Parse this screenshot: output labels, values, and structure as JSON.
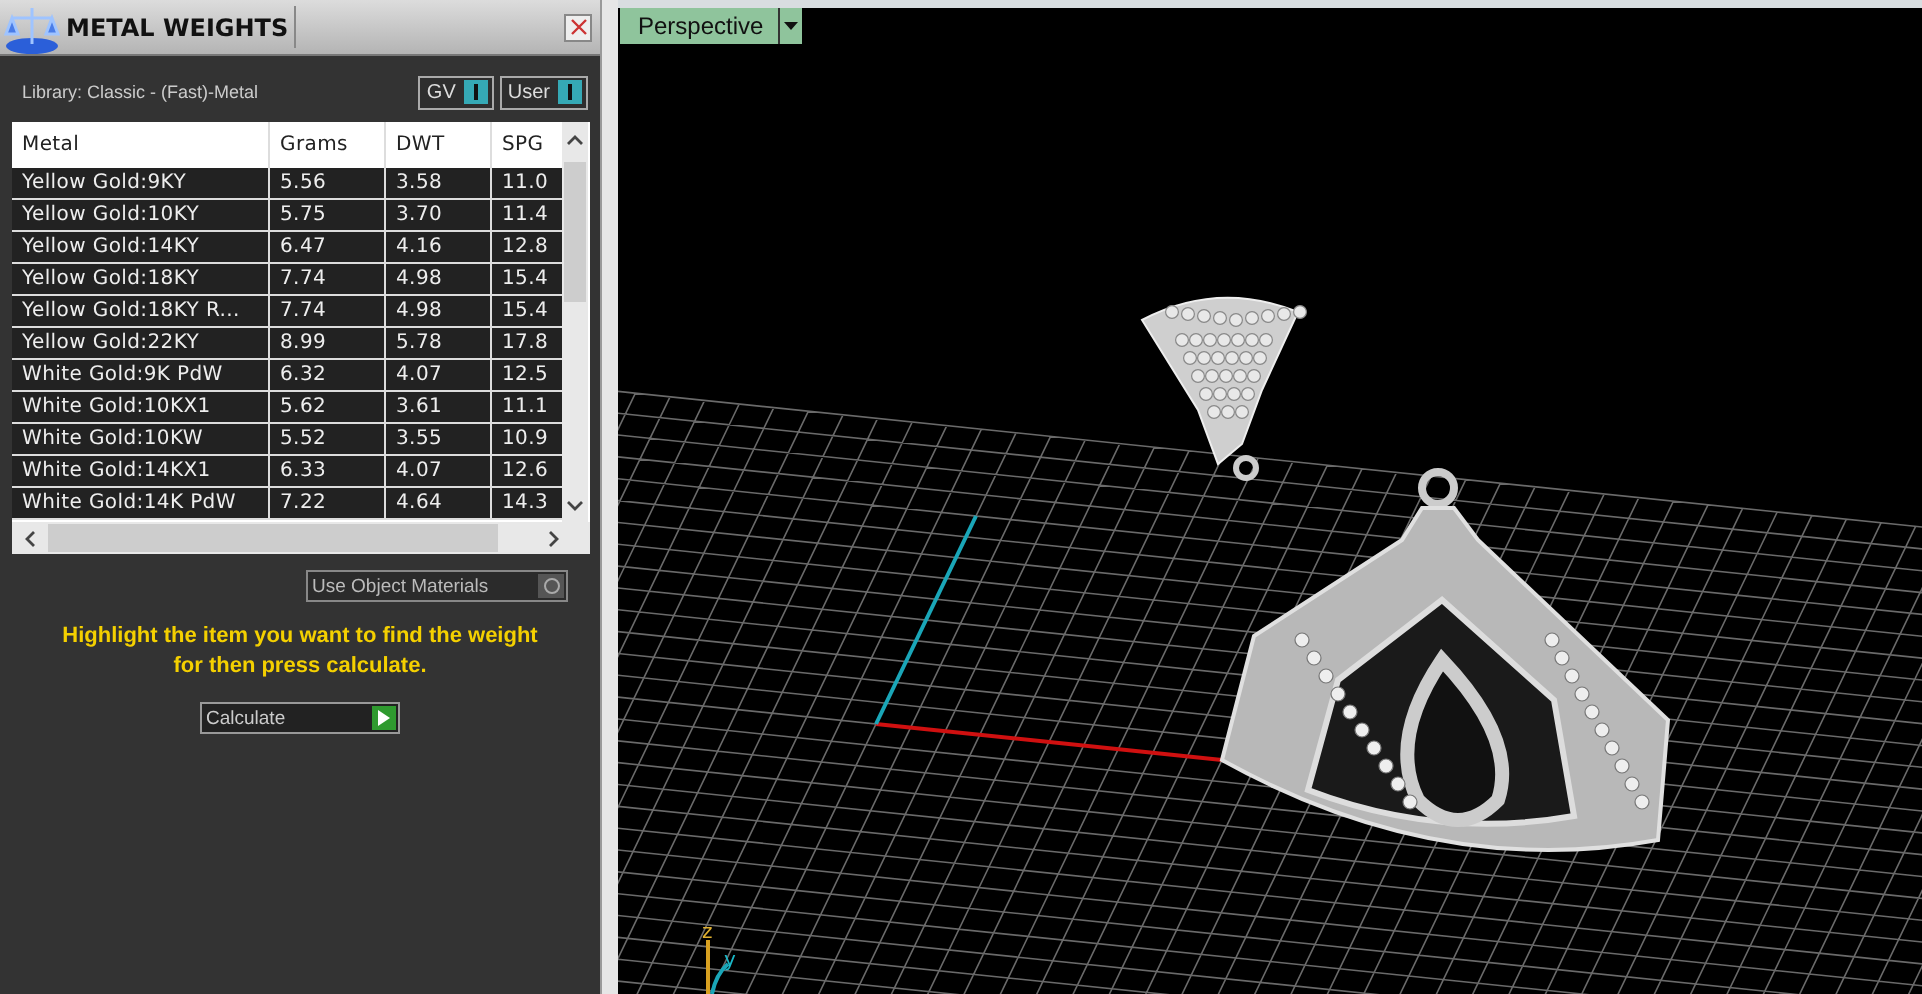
{
  "panel": {
    "title": "METAL WEIGHTS",
    "library": "Library: Classic - (Fast)-Metal",
    "toggles": [
      {
        "label": "GV",
        "on": true
      },
      {
        "label": "User",
        "on": true
      }
    ],
    "table": {
      "columns": [
        "Metal",
        "Grams",
        "DWT",
        "SPG"
      ],
      "rows": [
        [
          "Yellow Gold:9KY",
          "5.56",
          "3.58",
          "11.0"
        ],
        [
          "Yellow Gold:10KY",
          "5.75",
          "3.70",
          "11.4"
        ],
        [
          "Yellow Gold:14KY",
          "6.47",
          "4.16",
          "12.8"
        ],
        [
          "Yellow Gold:18KY",
          "7.74",
          "4.98",
          "15.4"
        ],
        [
          "Yellow Gold:18KY R...",
          "7.74",
          "4.98",
          "15.4"
        ],
        [
          "Yellow Gold:22KY",
          "8.99",
          "5.78",
          "17.8"
        ],
        [
          "White Gold:9K PdW",
          "6.32",
          "4.07",
          "12.5"
        ],
        [
          "White Gold:10KX1",
          "5.62",
          "3.61",
          "11.1"
        ],
        [
          "White Gold:10KW",
          "5.52",
          "3.55",
          "10.9"
        ],
        [
          "White Gold:14KX1",
          "6.33",
          "4.07",
          "12.6"
        ],
        [
          "White Gold:14K PdW",
          "7.22",
          "4.64",
          "14.3"
        ]
      ]
    },
    "use_object_materials": {
      "label": "Use Object Materials",
      "on": false
    },
    "hint": "Highlight the item you want to find the weight for then press calculate.",
    "calculate": "Calculate"
  },
  "viewport": {
    "view": "Perspective",
    "axis_labels": [
      "z",
      "y"
    ]
  }
}
